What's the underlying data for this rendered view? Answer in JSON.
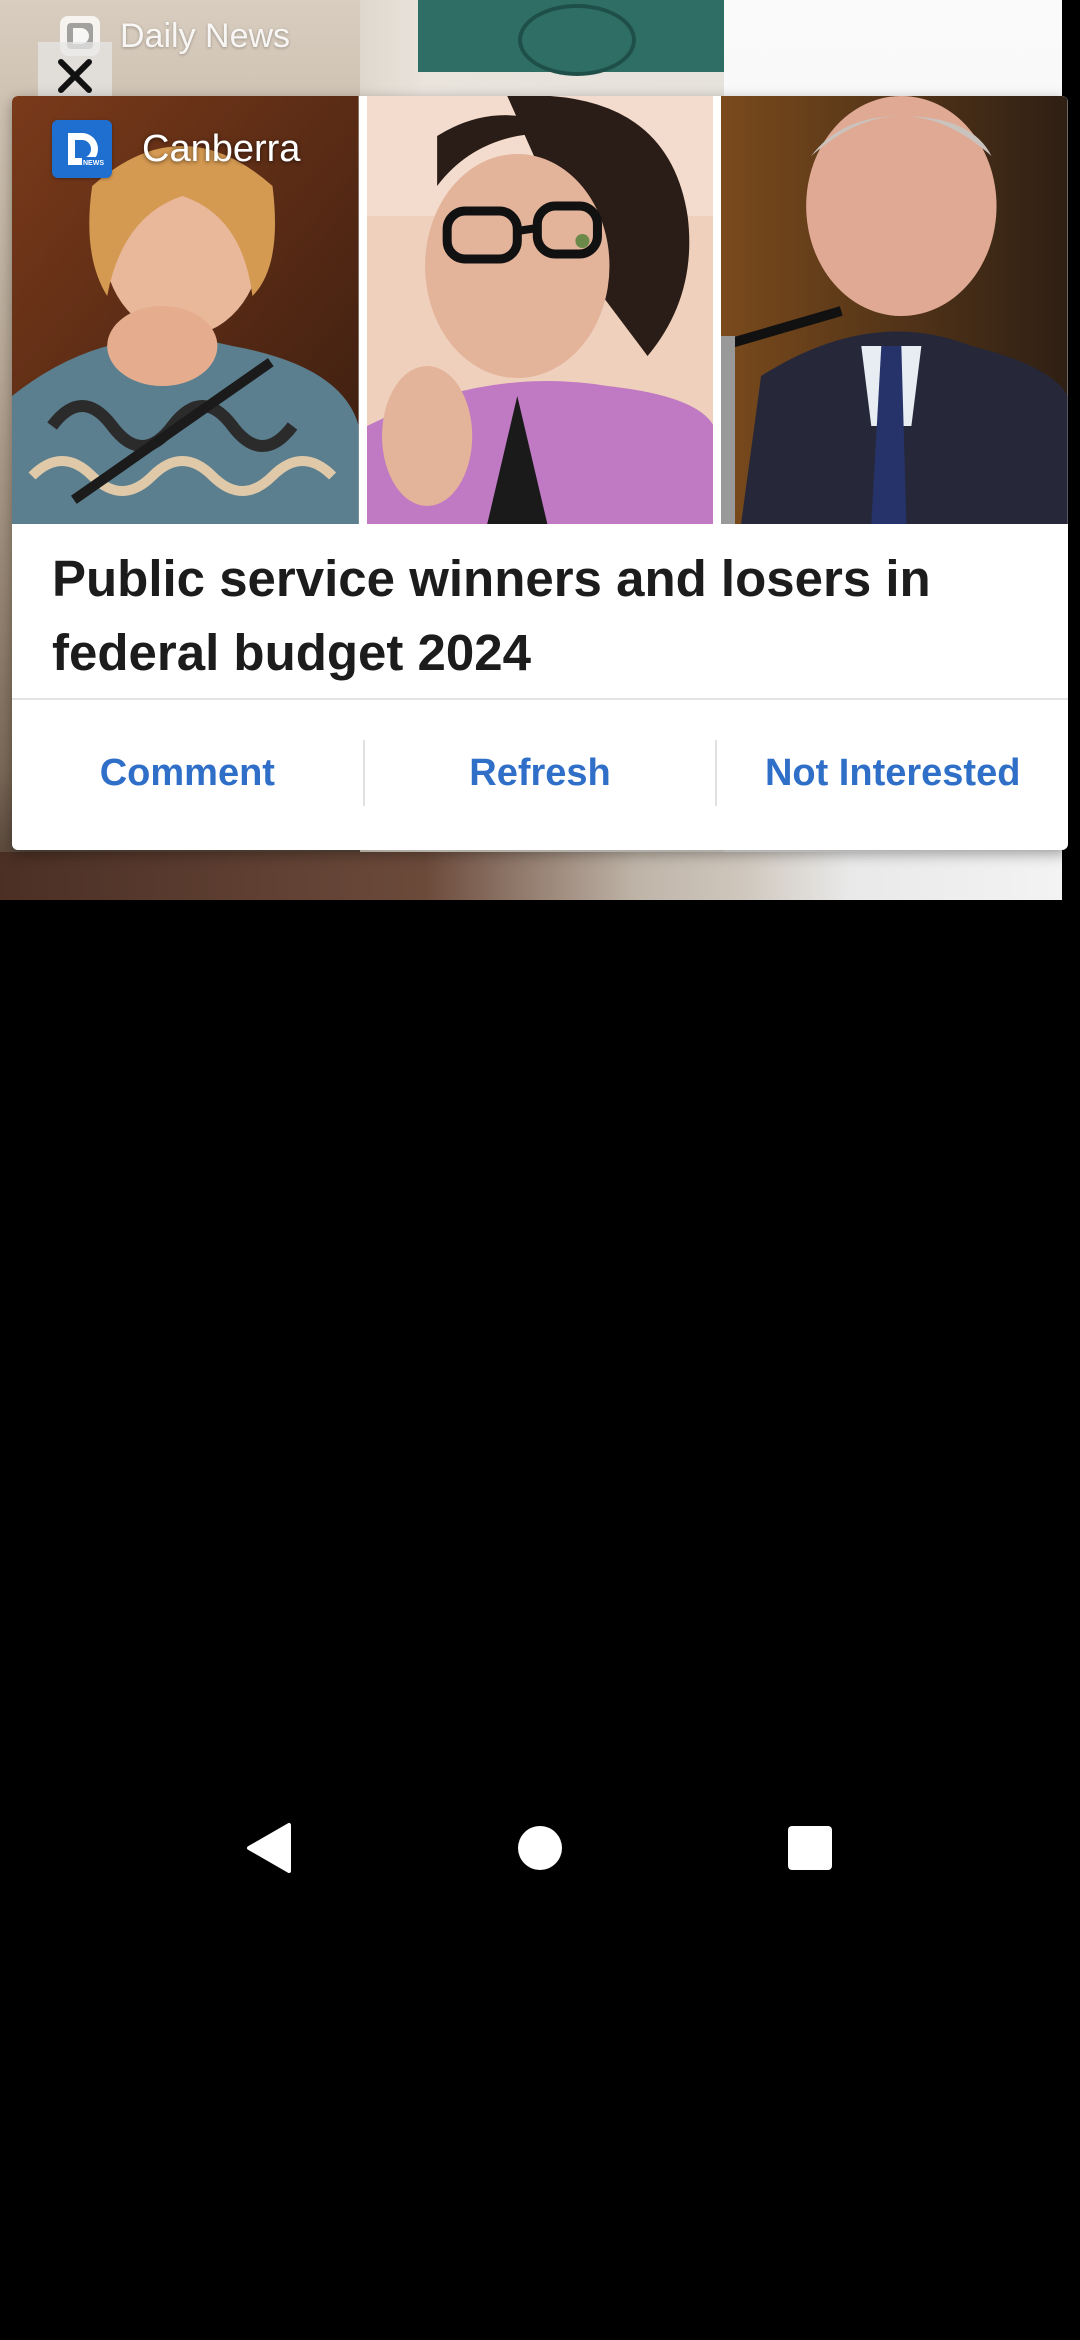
{
  "background_app": {
    "title": "Daily News",
    "icon": "daily-news-logo-icon"
  },
  "close_button": {
    "icon": "close-icon"
  },
  "card": {
    "source": {
      "name": "Canberra",
      "logo": "daily-news-logo-icon",
      "logo_color": "#1f6fd1"
    },
    "images": [
      {
        "name": "news-photo-woman-chin-on-hand"
      },
      {
        "name": "news-photo-woman-glasses-pink-jacket"
      },
      {
        "name": "news-photo-man-dark-suit"
      }
    ],
    "headline": "Public service winners and losers in federal budget 2024",
    "actions": [
      {
        "label": "Comment"
      },
      {
        "label": "Refresh"
      },
      {
        "label": "Not Interested"
      }
    ],
    "action_color": "#2f6fc8"
  },
  "nav_bar": {
    "back": "back-triangle-icon",
    "home": "home-circle-icon",
    "recents": "recents-square-icon"
  }
}
